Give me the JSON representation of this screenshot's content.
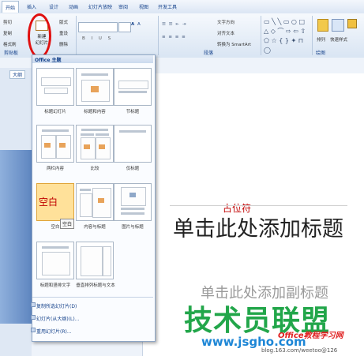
{
  "tabs": [
    "开始",
    "插入",
    "设计",
    "动画",
    "幻灯片放映",
    "审阅",
    "视图",
    "开发工具"
  ],
  "ribbon": {
    "clipboard": [
      "剪切",
      "复制",
      "格式刷"
    ],
    "new_slide": "新建\n幻灯片",
    "layout": [
      "版式",
      "重设",
      "删除"
    ],
    "groups": [
      "剪贴板",
      "段落",
      "绘图"
    ],
    "text_dir": "文字方向",
    "align_text": "对齐文本",
    "smartart": "转换为 SmartArt",
    "arrange": "排列",
    "quick_styles": "快速样式"
  },
  "outline_tab": "大纲",
  "gallery": {
    "theme": "Office 主题",
    "layouts": [
      "标题幻灯片",
      "标题和内容",
      "节标题",
      "两栏内容",
      "比较",
      "仅标题",
      "空白",
      "内容与标题",
      "图片与标题",
      "标题和竖排文字",
      "垂直排列标题与文本"
    ],
    "blank_big": "空白",
    "tooltip": "空白",
    "menu": [
      "复制所选幻灯片(D)",
      "幻灯片(从大纲)(L)...",
      "重用幻灯片(R)..."
    ]
  },
  "slide": {
    "placeholder_note": "占位符",
    "title": "单击此处添加标题",
    "subtitle": "单击此处添加副标题"
  },
  "watermark": {
    "brand": "技术员联盟",
    "url": "www.jsgho.com",
    "office": "Office教程学习网",
    "blog": "blog.163.com/weetoo@126"
  }
}
